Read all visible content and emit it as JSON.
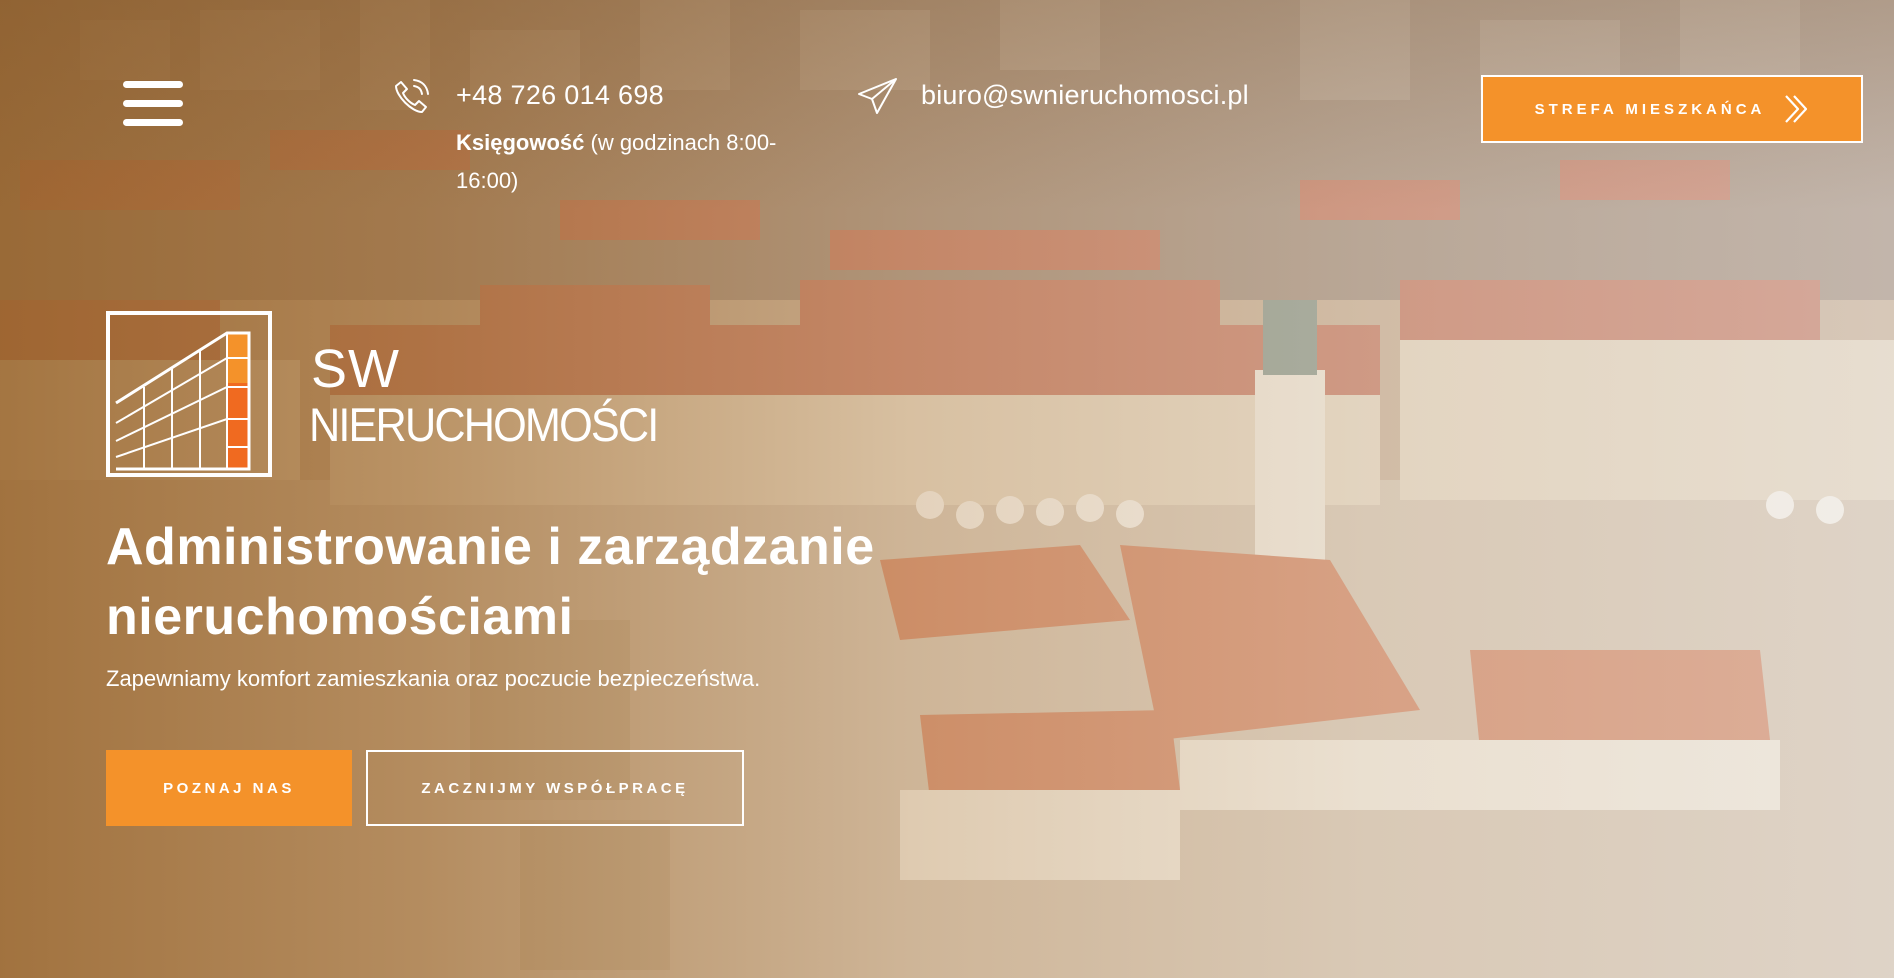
{
  "header": {
    "menu_icon": "hamburger-menu-icon",
    "phone": {
      "icon": "phone-icon",
      "number": "+48 726 014 698",
      "note_bold": "Księgowość",
      "note_rest": "(w godzinach 8:00-16:00)"
    },
    "email": {
      "icon": "paper-plane-icon",
      "address": "biuro@swnieruchomosci.pl"
    },
    "resident_button": {
      "label": "STREFA MIESZKAŃCA",
      "icon": "double-chevron-right-icon"
    }
  },
  "logo": {
    "icon": "building-logo-icon",
    "line1": "SW",
    "line2": "NIERUCHOMOŚCI"
  },
  "hero": {
    "headline": "Administrowanie i zarządzanie nieruchomościami",
    "subline": "Zapewniamy komfort zamieszkania oraz poczucie bezpieczeństwa.",
    "cta_primary": "POZNAJ NAS",
    "cta_secondary": "ZACZNIJMY WSPÓŁPRACĘ"
  },
  "colors": {
    "accent": "#f4922a",
    "text": "#ffffff",
    "overlay_warm": "#9b6830"
  }
}
